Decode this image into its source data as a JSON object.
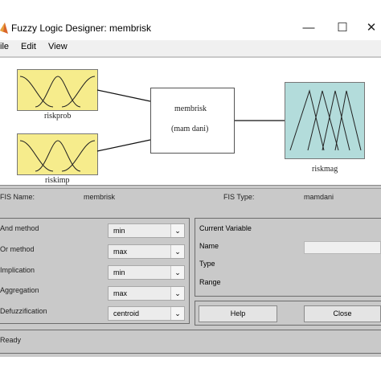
{
  "window": {
    "title": "Fuzzy Logic Designer: membrisk",
    "menu": [
      "ile",
      "Edit",
      "View"
    ]
  },
  "diagram": {
    "inputs": [
      {
        "label": "riskprob",
        "color": "#f6ec8c"
      },
      {
        "label": "riskimp",
        "color": "#f6ec8c"
      }
    ],
    "system": {
      "name": "membrisk",
      "type_label": "(mam dani)"
    },
    "output": {
      "label": "riskmag",
      "color": "#b3dcdb"
    }
  },
  "fis_info": {
    "name_label": "FIS Name:",
    "name_value": "membrisk",
    "type_label": "FIS Type:",
    "type_value": "mamdani"
  },
  "methods": [
    {
      "label": "And method",
      "value": "min"
    },
    {
      "label": "Or method",
      "value": "max"
    },
    {
      "label": "Implication",
      "value": "min"
    },
    {
      "label": "Aggregation",
      "value": "max"
    },
    {
      "label": "Defuzzification",
      "value": "centroid"
    }
  ],
  "current_variable": {
    "heading": "Current Variable",
    "name_label": "Name",
    "type_label": "Type",
    "range_label": "Range"
  },
  "buttons": {
    "help": "Help",
    "close": "Close"
  },
  "status": "Ready"
}
